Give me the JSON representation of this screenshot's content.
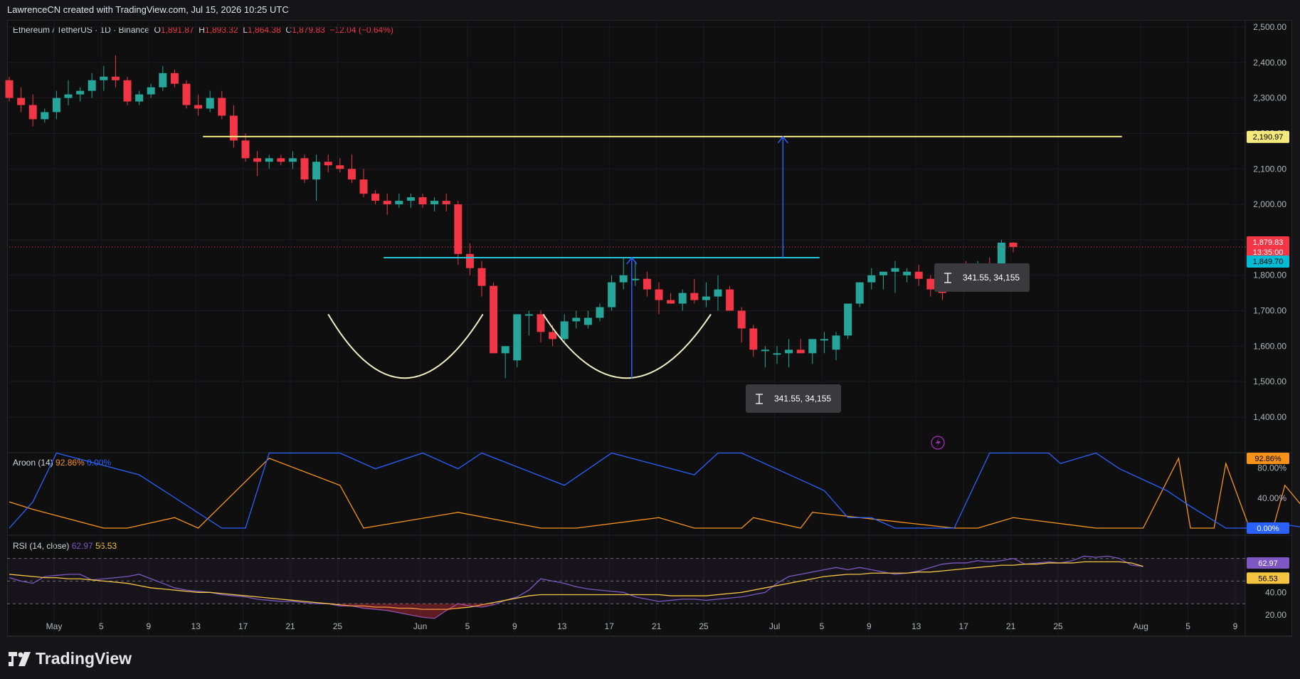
{
  "header": {
    "credit": "LawrenceCN created with TradingView.com, Jul 15, 2026 10:25 UTC"
  },
  "brand": {
    "name": "TradingView"
  },
  "legend": {
    "symbol": "Ethereum / TetherUS · 1D · Binance",
    "o_label": "O",
    "o": "1,891.87",
    "h_label": "H",
    "h": "1,893.32",
    "l_label": "L",
    "l": "1,864.38",
    "c_label": "C",
    "c": "1,879.83",
    "change": "−12.04 (−0.64%)"
  },
  "aroon_legend": {
    "name": "Aroon (14)",
    "up": "92.86%",
    "down": "0.00%"
  },
  "rsi_legend": {
    "name": "RSI (14, close)",
    "rsi": "62.97",
    "ma": "56.53"
  },
  "measure_labels": [
    "341.55, 34,155",
    "341.55, 34,155"
  ],
  "price_badges": {
    "target": "2,190.97",
    "last": "1,879.83",
    "countdown": "13:35:00",
    "neckline": "1,849.70",
    "aroon_up": "92.86%",
    "aroon_down": "0.00%",
    "rsi": "62.97",
    "rsi_ma": "56.53"
  },
  "colors": {
    "up": "#26a69a",
    "down": "#f23645",
    "target_line": "#f5e87c",
    "neckline": "#26c6da",
    "arrow": "#2962ff",
    "aroon_up": "#f7931a",
    "aroon_down": "#2962ff",
    "rsi": "#7e57c2",
    "rsi_ma": "#f5c542"
  },
  "chart_data": [
    {
      "type": "candlestick",
      "title": "Ethereum / TetherUS · 1D · Binance",
      "ylim": [
        1350,
        2520
      ],
      "y_ticks": [
        "2,500.00",
        "2,400.00",
        "2,300.00",
        "2,200.00",
        "2,100.00",
        "2,000.00",
        "1,900.00",
        "1,800.00",
        "1,700.00",
        "1,600.00",
        "1,500.00",
        "1,400.00"
      ],
      "y_tick_values": [
        2500,
        2400,
        2300,
        2200,
        2100,
        2000,
        1900,
        1800,
        1700,
        1600,
        1500,
        1400
      ],
      "x_ticks": [
        "May",
        "5",
        "9",
        "13",
        "17",
        "21",
        "25",
        "Jun",
        "5",
        "9",
        "13",
        "17",
        "21",
        "25",
        "Jul",
        "5",
        "9",
        "13",
        "17",
        "21",
        "25",
        "Aug",
        "5",
        "9"
      ],
      "x_tick_days": [
        0,
        4,
        8,
        12,
        16,
        20,
        24,
        31,
        35,
        39,
        43,
        47,
        51,
        55,
        61,
        65,
        69,
        73,
        77,
        81,
        85,
        92,
        96,
        100
      ],
      "x_start_date": "Apr 30",
      "ohlc": [
        [
          2350,
          2360,
          2290,
          2300
        ],
        [
          2300,
          2330,
          2260,
          2280
        ],
        [
          2280,
          2310,
          2220,
          2240
        ],
        [
          2240,
          2270,
          2230,
          2260
        ],
        [
          2260,
          2320,
          2240,
          2300
        ],
        [
          2300,
          2350,
          2280,
          2310
        ],
        [
          2310,
          2330,
          2290,
          2320
        ],
        [
          2320,
          2370,
          2300,
          2350
        ],
        [
          2350,
          2390,
          2320,
          2360
        ],
        [
          2360,
          2420,
          2330,
          2350
        ],
        [
          2350,
          2360,
          2280,
          2290
        ],
        [
          2290,
          2320,
          2280,
          2310
        ],
        [
          2310,
          2340,
          2300,
          2330
        ],
        [
          2330,
          2390,
          2320,
          2370
        ],
        [
          2370,
          2380,
          2330,
          2340
        ],
        [
          2340,
          2350,
          2270,
          2280
        ],
        [
          2280,
          2310,
          2250,
          2270
        ],
        [
          2270,
          2320,
          2260,
          2300
        ],
        [
          2300,
          2320,
          2240,
          2250
        ],
        [
          2250,
          2280,
          2160,
          2180
        ],
        [
          2180,
          2200,
          2120,
          2130
        ],
        [
          2130,
          2150,
          2080,
          2120
        ],
        [
          2120,
          2140,
          2100,
          2130
        ],
        [
          2130,
          2140,
          2110,
          2120
        ],
        [
          2120,
          2150,
          2100,
          2130
        ],
        [
          2130,
          2140,
          2060,
          2070
        ],
        [
          2070,
          2140,
          2010,
          2120
        ],
        [
          2120,
          2140,
          2090,
          2110
        ],
        [
          2110,
          2130,
          2090,
          2100
        ],
        [
          2100,
          2140,
          2060,
          2070
        ],
        [
          2070,
          2100,
          2020,
          2030
        ],
        [
          2030,
          2040,
          2000,
          2010
        ],
        [
          2010,
          2030,
          1970,
          2000
        ],
        [
          2000,
          2030,
          1990,
          2010
        ],
        [
          2010,
          2030,
          1990,
          2020
        ],
        [
          2020,
          2030,
          1990,
          2000
        ],
        [
          2000,
          2020,
          1980,
          2010
        ],
        [
          2010,
          2030,
          1980,
          2000
        ],
        [
          2000,
          2010,
          1830,
          1860
        ],
        [
          1860,
          1890,
          1800,
          1820
        ],
        [
          1820,
          1840,
          1740,
          1770
        ],
        [
          1770,
          1780,
          1580,
          1580
        ],
        [
          1580,
          1600,
          1510,
          1600
        ],
        [
          1560,
          1680,
          1540,
          1690
        ],
        [
          1690,
          1700,
          1630,
          1690
        ],
        [
          1690,
          1700,
          1610,
          1640
        ],
        [
          1640,
          1660,
          1600,
          1620
        ],
        [
          1620,
          1690,
          1610,
          1670
        ],
        [
          1670,
          1700,
          1650,
          1680
        ],
        [
          1660,
          1700,
          1650,
          1680
        ],
        [
          1680,
          1720,
          1670,
          1710
        ],
        [
          1710,
          1800,
          1700,
          1780
        ],
        [
          1780,
          1850,
          1760,
          1800
        ],
        [
          1790,
          1840,
          1770,
          1790
        ],
        [
          1790,
          1810,
          1740,
          1760
        ],
        [
          1760,
          1780,
          1690,
          1730
        ],
        [
          1730,
          1750,
          1720,
          1720
        ],
        [
          1720,
          1760,
          1700,
          1750
        ],
        [
          1750,
          1790,
          1720,
          1730
        ],
        [
          1730,
          1780,
          1710,
          1740
        ],
        [
          1740,
          1800,
          1700,
          1760
        ],
        [
          1760,
          1770,
          1700,
          1700
        ],
        [
          1700,
          1710,
          1610,
          1650
        ],
        [
          1650,
          1660,
          1570,
          1590
        ],
        [
          1590,
          1600,
          1540,
          1590
        ],
        [
          1580,
          1600,
          1550,
          1580
        ],
        [
          1580,
          1620,
          1540,
          1590
        ],
        [
          1590,
          1620,
          1580,
          1580
        ],
        [
          1580,
          1620,
          1550,
          1620
        ],
        [
          1620,
          1640,
          1580,
          1620
        ],
        [
          1590,
          1640,
          1560,
          1630
        ],
        [
          1630,
          1700,
          1620,
          1720
        ],
        [
          1720,
          1780,
          1710,
          1780
        ],
        [
          1780,
          1820,
          1760,
          1800
        ],
        [
          1800,
          1810,
          1760,
          1810
        ],
        [
          1810,
          1840,
          1750,
          1820
        ],
        [
          1800,
          1820,
          1780,
          1810
        ],
        [
          1810,
          1830,
          1770,
          1790
        ],
        [
          1790,
          1800,
          1740,
          1760
        ],
        [
          1760,
          1770,
          1730,
          1750
        ],
        [
          1760,
          1820,
          1760,
          1810
        ],
        [
          1810,
          1840,
          1790,
          1800
        ],
        [
          1800,
          1840,
          1790,
          1810
        ],
        [
          1810,
          1850,
          1760,
          1790
        ],
        [
          1780,
          1900,
          1780,
          1892
        ],
        [
          1891.87,
          1893.32,
          1864.38,
          1879.83
        ]
      ],
      "target_level": 2190.97,
      "neckline_level": 1849.7,
      "last_price": 1879.83
    },
    {
      "type": "line",
      "title": "Aroon (14)",
      "ylim": [
        0,
        100
      ],
      "y_ticks": [
        "80.00%",
        "40.00%"
      ],
      "y_tick_values": [
        80,
        40
      ],
      "series": [
        {
          "name": "Aroon Up",
          "color": "#f7931a",
          "x": [
            0,
            2,
            8,
            10,
            14,
            16,
            22,
            28,
            30,
            38,
            45,
            48,
            55,
            58,
            62,
            63,
            67,
            68,
            80,
            82,
            85,
            92,
            96,
            99,
            100,
            102,
            103,
            105,
            107,
            108,
            111,
            113
          ],
          "values": [
            35,
            25,
            0,
            0,
            14,
            0,
            93,
            57,
            0,
            21,
            0,
            0,
            14,
            0,
            0,
            14,
            0,
            21,
            0,
            0,
            14,
            0,
            0,
            93,
            0,
            0,
            86,
            0,
            0,
            57,
            0,
            93
          ]
        },
        {
          "name": "Aroon Down",
          "color": "#2962ff",
          "x": [
            0,
            2,
            4,
            11,
            18,
            20,
            22,
            28,
            31,
            35,
            38,
            40,
            47,
            51,
            58,
            60,
            62,
            69,
            71,
            73,
            75,
            80,
            83,
            88,
            89,
            92,
            94,
            98,
            100,
            103,
            105,
            107,
            110,
            113
          ],
          "values": [
            0,
            35,
            100,
            71,
            0,
            0,
            100,
            100,
            79,
            100,
            79,
            100,
            57,
            100,
            71,
            100,
            100,
            50,
            14,
            14,
            0,
            0,
            100,
            100,
            86,
            100,
            79,
            50,
            29,
            0,
            0,
            7,
            0,
            0
          ]
        }
      ]
    },
    {
      "type": "line",
      "title": "RSI (14, close)",
      "ylim": [
        10,
        80
      ],
      "y_ticks": [
        "40.00",
        "20.00"
      ],
      "y_tick_values": [
        40,
        20
      ],
      "series": [
        {
          "name": "RSI",
          "color": "#7e57c2",
          "values": [
            53,
            50,
            48,
            54,
            55,
            56,
            56,
            51,
            52,
            53,
            54,
            56,
            52,
            48,
            44,
            42,
            41,
            40,
            38,
            37,
            36,
            34,
            33,
            32,
            32,
            31,
            30,
            30,
            28,
            28,
            26,
            25,
            24,
            22,
            20,
            18,
            17,
            24,
            30,
            28,
            27,
            29,
            33,
            36,
            42,
            52,
            50,
            48,
            45,
            43,
            42,
            41,
            40,
            36,
            34,
            32,
            33,
            34,
            34,
            33,
            34,
            35,
            36,
            38,
            40,
            48,
            54,
            56,
            58,
            60,
            62,
            60,
            62,
            60,
            58,
            56,
            57,
            59,
            62,
            65,
            66,
            66,
            68,
            67,
            68,
            70,
            65,
            66,
            67,
            66,
            68,
            72,
            71,
            72,
            70,
            64,
            63
          ]
        },
        {
          "name": "RSI-based MA",
          "color": "#f5c542",
          "values": [
            56,
            55,
            54,
            53,
            53,
            52,
            52,
            51,
            50,
            49,
            48,
            46,
            44,
            43,
            42,
            41,
            40,
            40,
            39,
            38,
            37,
            36,
            35,
            34,
            33,
            32,
            31,
            30,
            29,
            28,
            28,
            27,
            27,
            26,
            26,
            25,
            25,
            25,
            26,
            27,
            29,
            31,
            33,
            35,
            37,
            38,
            38,
            38,
            38,
            38,
            38,
            38,
            38,
            38,
            38,
            38,
            37,
            37,
            37,
            37,
            38,
            39,
            40,
            42,
            44,
            46,
            48,
            50,
            52,
            54,
            55,
            56,
            56,
            57,
            57,
            57,
            57,
            58,
            58,
            59,
            60,
            61,
            62,
            63,
            64,
            64,
            65,
            65,
            66,
            66,
            66,
            67,
            67,
            67,
            67,
            66,
            63
          ]
        }
      ]
    }
  ]
}
